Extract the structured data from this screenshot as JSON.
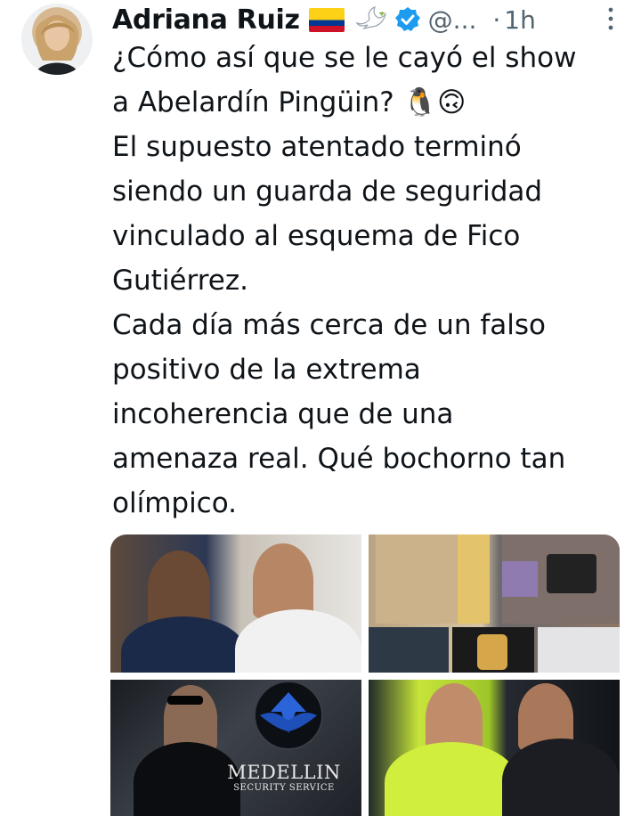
{
  "tweet": {
    "author_name": "Adriana Ruiz",
    "handle": "@...",
    "separator": "·",
    "time": "1h",
    "body_lines": [
      "¿Cómo así que se le cayó el show",
      "a Abelardín Pingüin? 🐧🙃",
      "El supuesto atentado terminó",
      "siendo un guarda de seguridad",
      "vinculado al esquema de Fico",
      "Gutiérrez.",
      "Cada día más cerca de un falso",
      "positivo de la extrema",
      "incoherencia que de una",
      "amenaza real. Qué bochorno tan",
      "olímpico."
    ],
    "icons": {
      "flag": "colombia-flag-icon",
      "dove": "dove-icon",
      "verified": "verified-badge-icon",
      "more": "more-options-icon"
    },
    "colors": {
      "text": "#0f1419",
      "secondary": "#536471",
      "verified": "#1d9bf0"
    }
  },
  "media": {
    "count": 4,
    "photo3_text_line1": "MEDELLIN",
    "photo3_text_line2": "SECURITY SERVICE"
  }
}
